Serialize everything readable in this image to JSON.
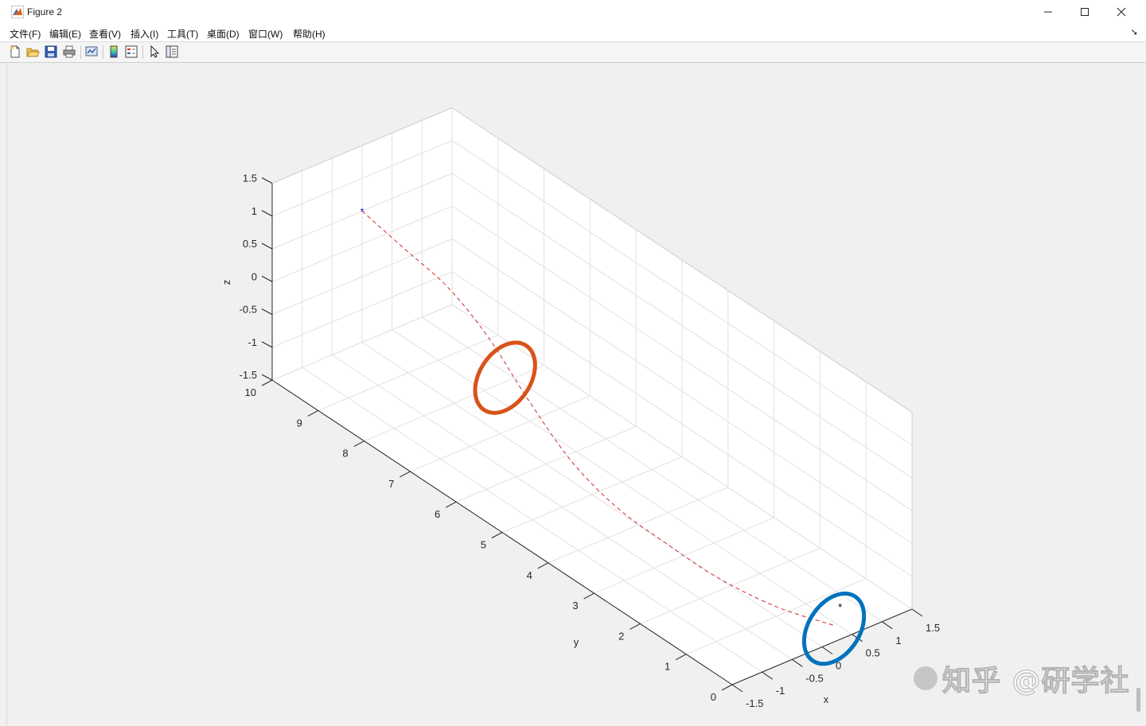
{
  "window": {
    "title": "Figure 2"
  },
  "menu": [
    "文件(F)",
    "编辑(E)",
    "查看(V)",
    "插入(I)",
    "工具(T)",
    "桌面(D)",
    "窗口(W)",
    "帮助(H)"
  ],
  "toolbar": [
    "new-figure-icon",
    "open-file-icon",
    "save-icon",
    "print-icon",
    "link-plot-icon",
    "colorbar-icon",
    "legend-icon",
    "pointer-icon",
    "property-inspector-icon"
  ],
  "chart_data": {
    "type": "line",
    "xlabel": "x",
    "ylabel": "y",
    "zlabel": "z",
    "xlim": [
      -1.5,
      1.5
    ],
    "ylim": [
      0,
      10
    ],
    "zlim": [
      -1.5,
      1.5
    ],
    "xticks": [
      "-1.5",
      "-1",
      "-0.5",
      "0",
      "0.5",
      "1",
      "1.5"
    ],
    "yticks": [
      "0",
      "1",
      "2",
      "3",
      "4",
      "5",
      "6",
      "7",
      "8",
      "9",
      "10"
    ],
    "zticks": [
      "-1.5",
      "-1",
      "-0.5",
      "0",
      "0.5",
      "1",
      "1.5"
    ],
    "grid": true,
    "series": [
      {
        "style": "dashed",
        "color": "#d62728",
        "points": [
          [
            0,
            10,
            0.5
          ],
          [
            -0.05,
            9,
            0.4
          ],
          [
            -0.1,
            8,
            0.3
          ],
          [
            -0.2,
            7,
            0.05
          ],
          [
            -0.3,
            6,
            -0.4
          ],
          [
            -0.35,
            5,
            -0.85
          ],
          [
            -0.35,
            4,
            -1.1
          ],
          [
            -0.3,
            3,
            -1.2
          ],
          [
            -0.2,
            2,
            -1.3
          ],
          [
            0,
            1,
            -1.35
          ],
          [
            0.2,
            0,
            -1.25
          ]
        ]
      },
      {
        "style": "ring",
        "color": "#d95319",
        "center": [
          -0.3,
          6.5,
          -0.3
        ],
        "radius": 0.5
      },
      {
        "style": "ring",
        "color": "#0072bd",
        "center": [
          0.2,
          0,
          -1.3
        ],
        "radius": 0.5
      },
      {
        "style": "marker",
        "marker": "*",
        "color": "#1f1fcf",
        "point": [
          0,
          10,
          0.5
        ]
      },
      {
        "style": "marker",
        "marker": "*",
        "color": "#000000",
        "point": [
          0.3,
          0,
          -1.0
        ]
      }
    ]
  },
  "watermark": {
    "text": "知乎 @研学社"
  },
  "colors": {
    "ring_orange": "#d95319",
    "ring_blue": "#0072bd",
    "path": "#d62728"
  }
}
